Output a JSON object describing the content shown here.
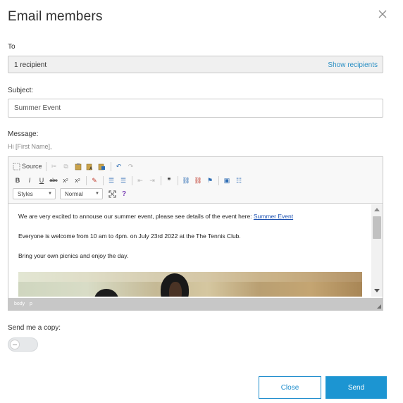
{
  "dialog": {
    "title": "Email members",
    "close_icon": "close-icon"
  },
  "to": {
    "label": "To",
    "recipients": "1 recipient",
    "show_link": "Show recipients"
  },
  "subject": {
    "label": "Subject:",
    "value": "Summer Event"
  },
  "message": {
    "label": "Message:",
    "hint": "Hi [First Name],"
  },
  "toolbar": {
    "source_label": "Source",
    "bold": "B",
    "italic": "I",
    "underline": "U",
    "strike": "abc",
    "subscript": "x",
    "superscript": "x",
    "styles_label": "Styles",
    "format_label": "Normal",
    "help_label": "?"
  },
  "content": {
    "line1_text": "We are very excited to annouse our summer event, please see details of the event here: ",
    "line1_link": "Summer Event",
    "line2": "Everyone is welcome from 10 am to 4pm. on July 23rd 2022 at the The Tennis Club.",
    "line3": "Bring your own picnics and enjoy the day."
  },
  "pathbar": {
    "path1": "body",
    "path2": "p"
  },
  "copy": {
    "label": "Send me a copy:",
    "enabled": false
  },
  "buttons": {
    "close": "Close",
    "send": "Send"
  },
  "colors": {
    "accent": "#1c95d2",
    "link": "#2a8fc4"
  }
}
